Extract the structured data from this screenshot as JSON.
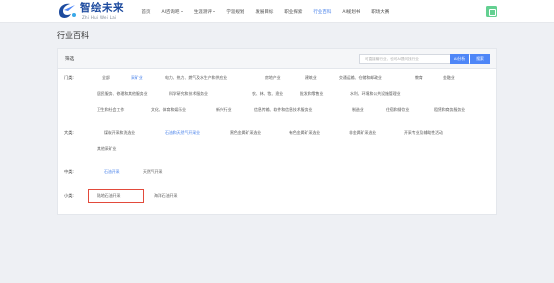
{
  "header": {
    "logo_title": "智绘未来",
    "logo_sub": "Zhi Hui Wei Lai",
    "nav": [
      {
        "label": "首页",
        "caret": false,
        "active": false
      },
      {
        "label": "AI咨询吧",
        "caret": true,
        "active": false
      },
      {
        "label": "生涯测评",
        "caret": true,
        "active": false
      },
      {
        "label": "学涯规划",
        "caret": false,
        "active": false
      },
      {
        "label": "发展目标",
        "caret": false,
        "active": false
      },
      {
        "label": "职业探索",
        "caret": false,
        "active": false
      },
      {
        "label": "行业百科",
        "caret": false,
        "active": true
      },
      {
        "label": "AI规划书",
        "caret": false,
        "active": false
      },
      {
        "label": "职场大赛",
        "caret": false,
        "active": false
      }
    ]
  },
  "page": {
    "title": "行业百科"
  },
  "filter": {
    "label": "筛选",
    "search_placeholder": "可直接输行业，也可AI提问找行业",
    "ai_button": "AI分析",
    "search_button": "搜索"
  },
  "rows": {
    "menlei": {
      "label": "门类:",
      "tags": [
        {
          "text": "全部",
          "active": false
        },
        {
          "text": "采矿业",
          "active": true
        },
        {
          "text": "电力、热力、燃气及水生产和供应业",
          "active": false
        },
        {
          "text": "房地产业",
          "active": false
        },
        {
          "text": "建筑业",
          "active": false
        },
        {
          "text": "交通运输、仓储和邮政业",
          "active": false
        },
        {
          "text": "教育",
          "active": false
        },
        {
          "text": "金融业",
          "active": false
        },
        {
          "text": "居民服务、修理和其他服务业",
          "active": false
        },
        {
          "text": "科学研究和技术服务业",
          "active": false
        },
        {
          "text": "农、林、牧、渔业",
          "active": false
        },
        {
          "text": "批发和零售业",
          "active": false
        },
        {
          "text": "水利、环境和公共设施管理业",
          "active": false
        },
        {
          "text": "卫生和社会工作",
          "active": false
        },
        {
          "text": "文化、体育和娱乐业",
          "active": false
        },
        {
          "text": "新兴行业",
          "active": false
        },
        {
          "text": "信息传输、软件和信息技术服务业",
          "active": false
        },
        {
          "text": "制造业",
          "active": false
        },
        {
          "text": "住宿和餐饮业",
          "active": false
        },
        {
          "text": "租赁和商务服务业",
          "active": false
        }
      ]
    },
    "dalei": {
      "label": "大类:",
      "tags": [
        {
          "text": "煤炭开采和洗选业",
          "active": false
        },
        {
          "text": "石油和天然气开采业",
          "active": true
        },
        {
          "text": "黑色金属矿采选业",
          "active": false
        },
        {
          "text": "有色金属矿采选业",
          "active": false
        },
        {
          "text": "非金属矿采选业",
          "active": false
        },
        {
          "text": "开采专业及辅助性活动",
          "active": false
        },
        {
          "text": "其他采矿业",
          "active": false
        }
      ]
    },
    "zhonglei": {
      "label": "中类:",
      "tags": [
        {
          "text": "石油开采",
          "active": true
        },
        {
          "text": "天然气开采",
          "active": false
        }
      ]
    },
    "xiaolei": {
      "label": "小类:",
      "tags": [
        {
          "text": "陆地石油开采",
          "active": false
        },
        {
          "text": "海洋石油开采",
          "active": false
        }
      ]
    }
  }
}
